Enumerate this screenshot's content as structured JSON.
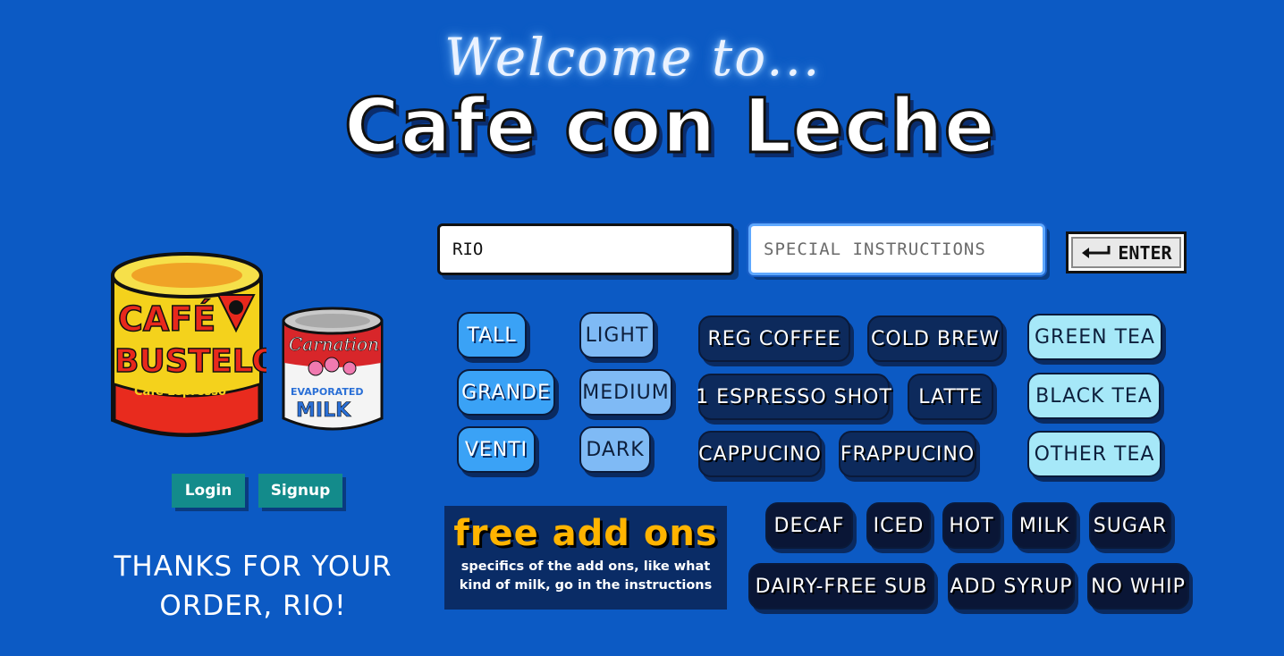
{
  "header": {
    "welcome": "Welcome to...",
    "title": "Cafe con Leche"
  },
  "images": {
    "bustelo": {
      "brand": "CAFÉ BUSTELO",
      "line1": "CAFÉ",
      "line2": "BUSTELO",
      "sub": "Cafe Espresso"
    },
    "carnation": {
      "brand": "Carnation",
      "line1": "EVAPORATED",
      "line2": "MILK"
    }
  },
  "auth": {
    "login": "Login",
    "signup": "Signup"
  },
  "thanks": "THANKS FOR YOUR ORDER, RIO!",
  "form": {
    "name_value": "RIO",
    "instructions_placeholder": "SPECIAL INSTRUCTIONS",
    "enter_label": "ENTER"
  },
  "sizes": [
    "TALL",
    "GRANDE",
    "VENTI"
  ],
  "roasts": [
    "LIGHT",
    "MEDIUM",
    "DARK"
  ],
  "drinks": [
    "REG COFFEE",
    "COLD BREW",
    "1 ESPRESSO SHOT",
    "LATTE",
    "CAPPUCINO",
    "FRAPPUCINO"
  ],
  "teas": [
    "GREEN TEA",
    "BLACK TEA",
    "OTHER TEA"
  ],
  "addons_box": {
    "title": "free add ons",
    "subtitle": "specifics of the add ons, like what kind of milk, go in the instructions"
  },
  "addons": [
    "DECAF",
    "ICED",
    "HOT",
    "MILK",
    "SUGAR",
    "DAIRY-FREE SUB",
    "ADD SYRUP",
    "NO WHIP"
  ],
  "colors": {
    "background": "#0c5ac4",
    "size_button": "#3aa2f6",
    "roast_button": "#7fbaf5",
    "drink_button": "#0d2a5c",
    "tea_button": "#a6e8f8",
    "addon_button": "#0a1636",
    "auth_button": "#138b8b",
    "addon_title": "#ffb400"
  }
}
